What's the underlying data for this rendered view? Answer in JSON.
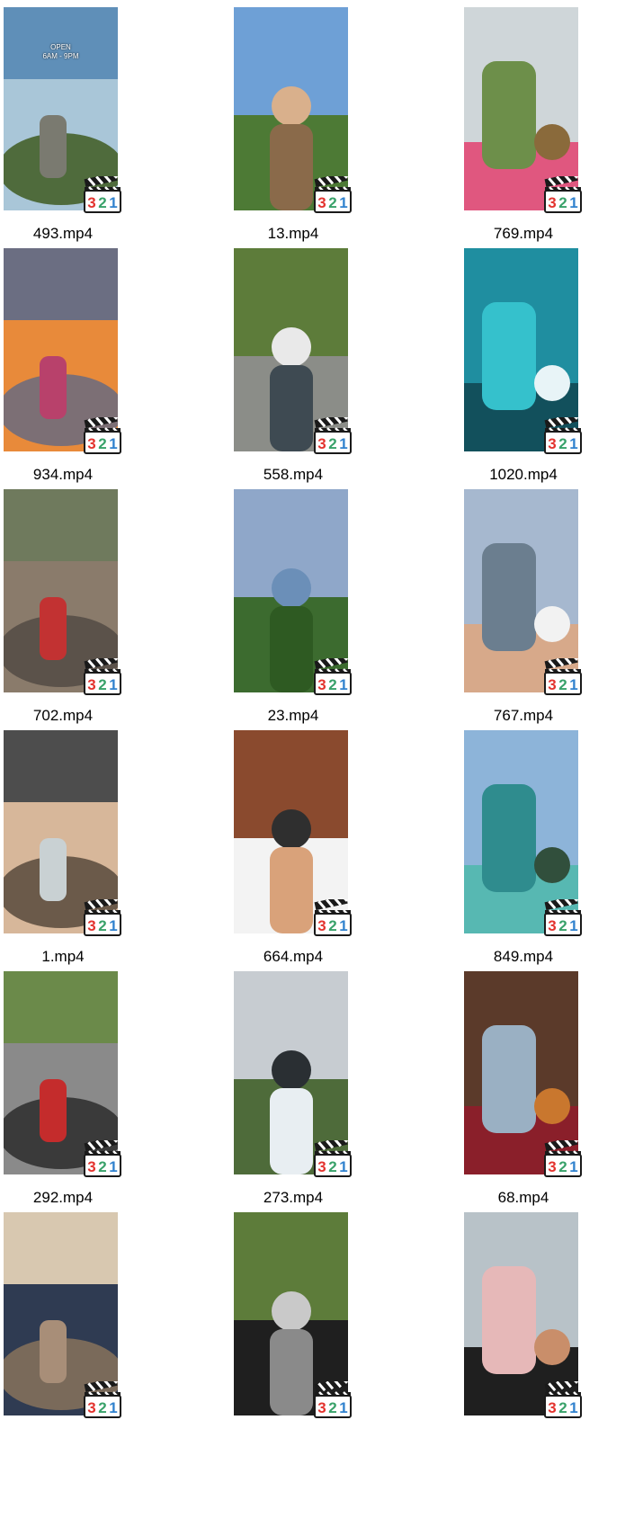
{
  "files": [
    {
      "name": "493.mp4",
      "overlay_text": "OPEN\n6AM - 9PM",
      "palette": [
        "#5f8fb8",
        "#a9c6d8",
        "#4f6b3c",
        "#7a7a70"
      ]
    },
    {
      "name": "13.mp4",
      "palette": [
        "#6ea0d6",
        "#4d7a35",
        "#8a6a4a",
        "#d9b08c"
      ]
    },
    {
      "name": "769.mp4",
      "palette": [
        "#cfd6d9",
        "#6d8f4a",
        "#e0577f",
        "#8a6a3b"
      ]
    },
    {
      "name": "934.mp4",
      "palette": [
        "#6b6e82",
        "#e88a3a",
        "#7c6f75",
        "#b8416b"
      ]
    },
    {
      "name": "558.mp4",
      "palette": [
        "#5d7c3a",
        "#8b8d88",
        "#3e4a52",
        "#e9e9e9"
      ]
    },
    {
      "name": "1020.mp4",
      "palette": [
        "#1f8ea0",
        "#35c1cc",
        "#12505c",
        "#e8f4f7"
      ]
    },
    {
      "name": "702.mp4",
      "palette": [
        "#6f7a5d",
        "#8a7b6b",
        "#5b524a",
        "#c23232"
      ]
    },
    {
      "name": "23.mp4",
      "palette": [
        "#8fa7c9",
        "#3c6b2f",
        "#2e5a22",
        "#6b8fb8"
      ]
    },
    {
      "name": "767.mp4",
      "palette": [
        "#a6b8cf",
        "#6b7e8f",
        "#d7a98a",
        "#f2f2f2"
      ]
    },
    {
      "name": "1.mp4",
      "palette": [
        "#4d4d4d",
        "#d7b79a",
        "#6b5a4a",
        "#c9d1d3"
      ]
    },
    {
      "name": "664.mp4",
      "palette": [
        "#8a4a2e",
        "#f3f3f3",
        "#d9a27a",
        "#2f2f2f"
      ]
    },
    {
      "name": "849.mp4",
      "palette": [
        "#8db4d9",
        "#2f8c8e",
        "#57b8b2",
        "#314f3c"
      ]
    },
    {
      "name": "292.mp4",
      "palette": [
        "#6b8a4a",
        "#8a8a8a",
        "#3a3a3a",
        "#c42c2c"
      ]
    },
    {
      "name": "273.mp4",
      "palette": [
        "#c7ccd1",
        "#4e6b3a",
        "#e8eef2",
        "#2a2f33"
      ]
    },
    {
      "name": "68.mp4",
      "palette": [
        "#5b3a2a",
        "#9ab0c3",
        "#8a1f2a",
        "#c9772e"
      ]
    },
    {
      "name": "",
      "palette": [
        "#d8c8b0",
        "#2f3b52",
        "#7a6a5a",
        "#a88e78"
      ]
    },
    {
      "name": "",
      "palette": [
        "#5d7c3a",
        "#1f1f1f",
        "#8a8a8a",
        "#c9c9c9"
      ]
    },
    {
      "name": "",
      "palette": [
        "#b8c2c8",
        "#e6b8b8",
        "#1f1f1f",
        "#c98e6a"
      ]
    }
  ],
  "badge": {
    "label": "321",
    "digit_colors": [
      "#e3342f",
      "#38a169",
      "#3182ce"
    ]
  }
}
